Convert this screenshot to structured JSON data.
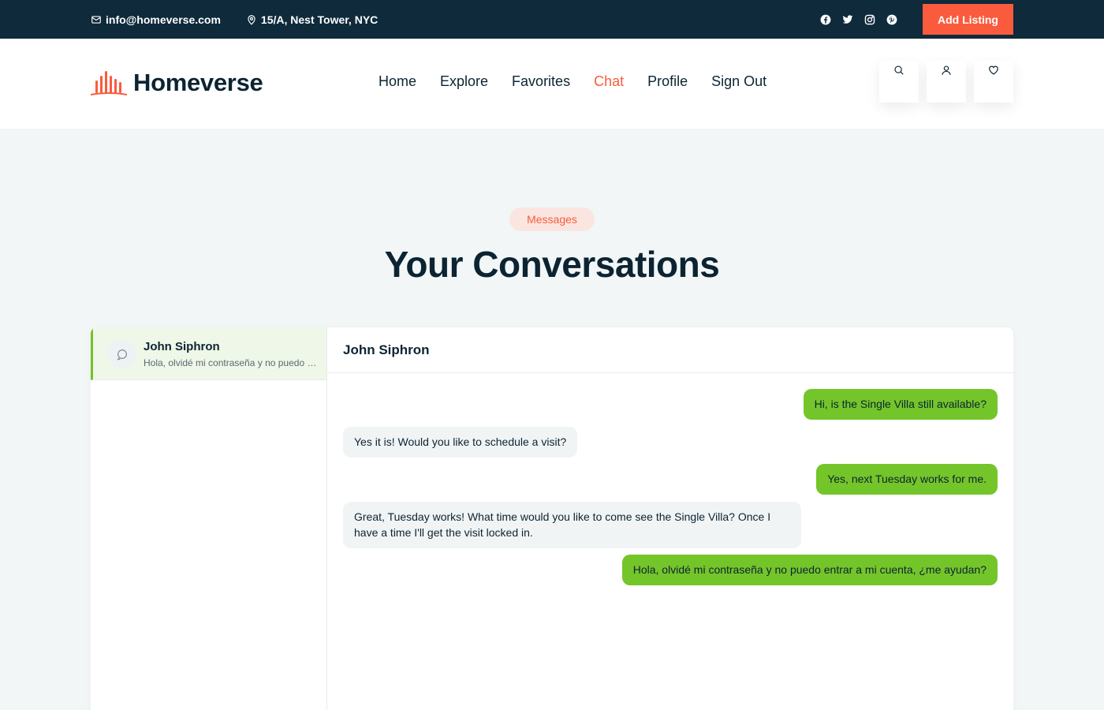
{
  "topbar": {
    "email": "info@homeverse.com",
    "address": "15/A, Nest Tower, NYC",
    "socials": [
      "facebook-icon",
      "twitter-icon",
      "instagram-icon",
      "pinterest-icon"
    ],
    "add_listing_label": "Add Listing"
  },
  "header": {
    "brand": "Homeverse",
    "nav": [
      {
        "label": "Home",
        "active": false
      },
      {
        "label": "Explore",
        "active": false
      },
      {
        "label": "Favorites",
        "active": false
      },
      {
        "label": "Chat",
        "active": true
      },
      {
        "label": "Profile",
        "active": false
      },
      {
        "label": "Sign Out",
        "active": false
      }
    ],
    "actions": [
      "search-icon",
      "user-icon",
      "heart-icon"
    ]
  },
  "section": {
    "badge": "Messages",
    "title": "Your Conversations"
  },
  "conversations": [
    {
      "name": "John Siphron",
      "preview": "Hola, olvidé mi contraseña y no puedo entrar a mi cuenta, ¿me ayudan?",
      "selected": true
    }
  ],
  "chat": {
    "title": "John Siphron",
    "messages": [
      {
        "direction": "out",
        "text": "Hi, is the Single Villa still available?"
      },
      {
        "direction": "in",
        "text": "Yes it is! Would you like to schedule a visit?"
      },
      {
        "direction": "out",
        "text": "Yes, next Tuesday works for me."
      },
      {
        "direction": "in",
        "text": "Great, Tuesday works! What time would you like to come see the Single Villa? Once I have a time I'll get the visit locked in."
      },
      {
        "direction": "out",
        "text": "Hola, olvidé mi contraseña y no puedo entrar a mi cuenta, ¿me ayudan?"
      }
    ]
  },
  "colors": {
    "topbar_bg": "#0e2a3b",
    "accent": "#fa5b3d",
    "outgoing_bubble": "#74c52a",
    "incoming_bubble": "#f1f4f5",
    "page_bg": "#f2f6f7",
    "text_dark": "#0c2431"
  }
}
